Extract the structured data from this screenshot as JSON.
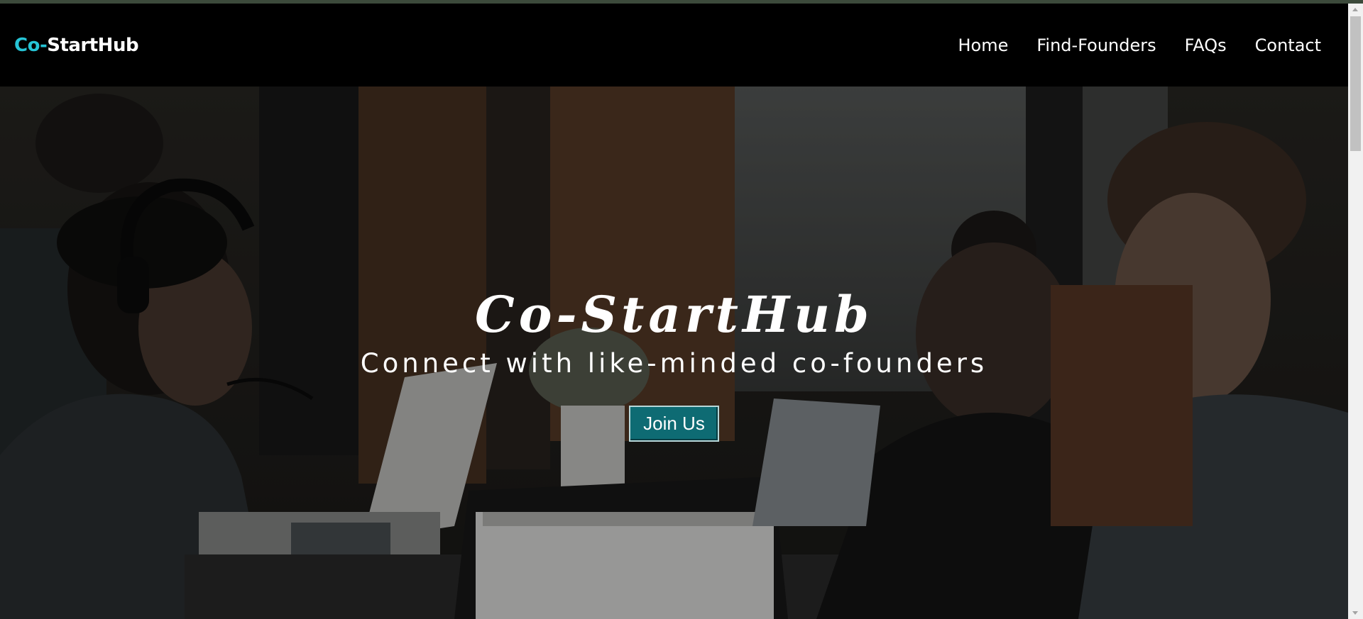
{
  "navbar": {
    "brand_accent": "Co-",
    "brand_rest": "StartHub",
    "links": [
      {
        "label": "Home"
      },
      {
        "label": "Find-Founders"
      },
      {
        "label": "FAQs"
      },
      {
        "label": "Contact"
      }
    ]
  },
  "hero": {
    "title": "Co-StartHub",
    "subtitle": "Connect with like-minded co-founders",
    "cta_label": "Join Us",
    "background_description": "photo-of-people-working-on-laptops"
  },
  "colors": {
    "accent": "#26c4d6",
    "button": "#0e6b73",
    "navbar": "#000000"
  }
}
